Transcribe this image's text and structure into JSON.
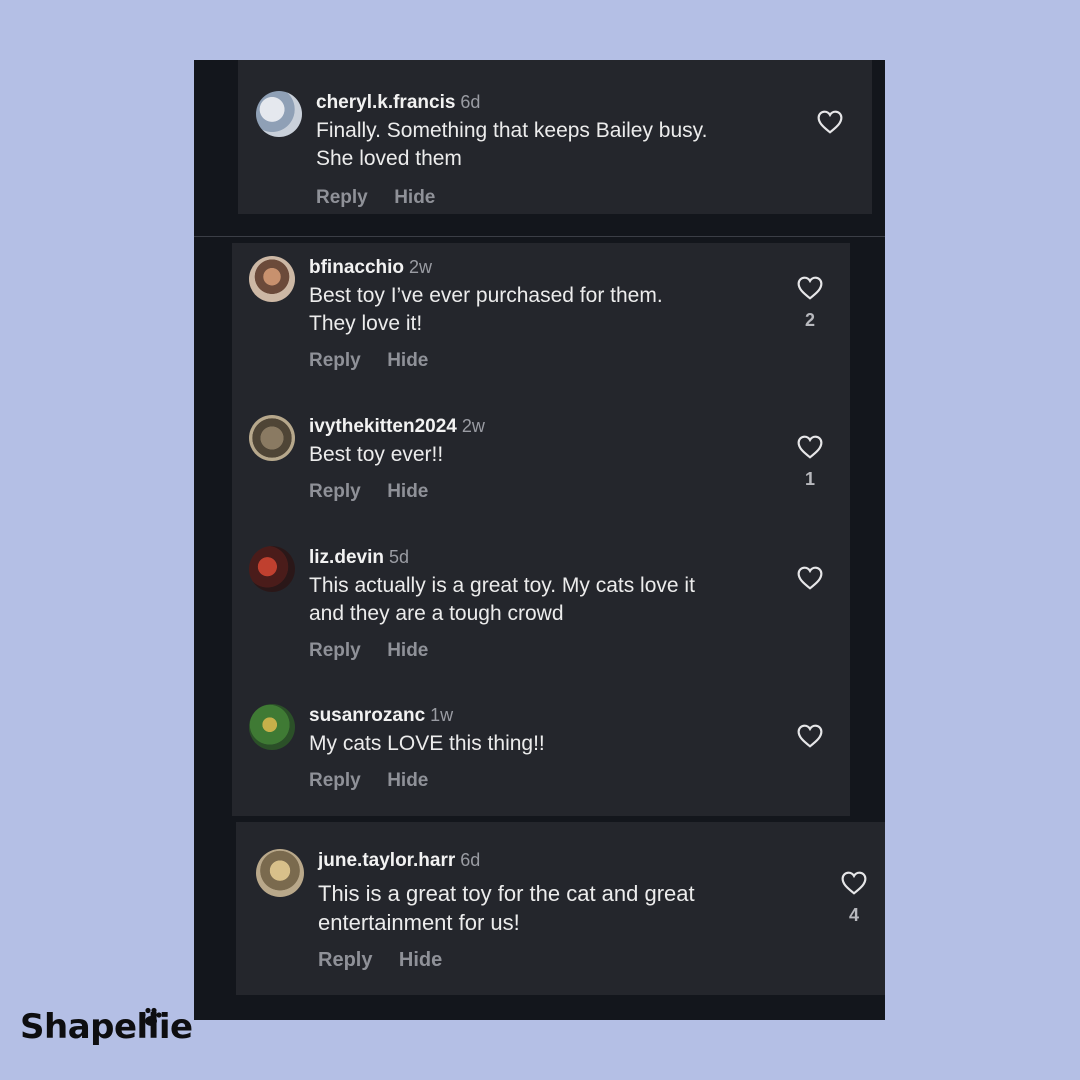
{
  "comments": [
    {
      "username": "cheryl.k.francis",
      "age": "6d",
      "lines": [
        "Finally. Something that keeps Bailey busy.",
        "She loved them"
      ],
      "reply": "Reply",
      "hide": "Hide",
      "likes": ""
    },
    {
      "username": "bfinacchio",
      "age": "2w",
      "lines": [
        "Best toy I’ve ever purchased for them.",
        "They love it!"
      ],
      "reply": "Reply",
      "hide": "Hide",
      "likes": "2"
    },
    {
      "username": "ivythekitten2024",
      "age": "2w",
      "lines": [
        "Best toy ever!!"
      ],
      "reply": "Reply",
      "hide": "Hide",
      "likes": "1"
    },
    {
      "username": "liz.devin",
      "age": "5d",
      "lines": [
        "This actually is a great toy. My cats love it",
        "and they are a tough crowd"
      ],
      "reply": "Reply",
      "hide": "Hide",
      "likes": ""
    },
    {
      "username": "susanrozanc",
      "age": "1w",
      "lines": [
        "My cats LOVE this thing!!"
      ],
      "reply": "Reply",
      "hide": "Hide",
      "likes": ""
    },
    {
      "username": "june.taylor.harr",
      "age": "6d",
      "lines": [
        "This is a great toy for the cat and great",
        "entertainment for us!"
      ],
      "reply": "Reply",
      "hide": "Hide",
      "likes": "4"
    }
  ],
  "brand": {
    "name": "Shapellie"
  },
  "colors": {
    "background": "#b4bfe5",
    "panel": "#13161c",
    "card": "#24262c"
  },
  "icons": {
    "like": "heart-outline-icon",
    "logo_mark": "paw-icon"
  }
}
